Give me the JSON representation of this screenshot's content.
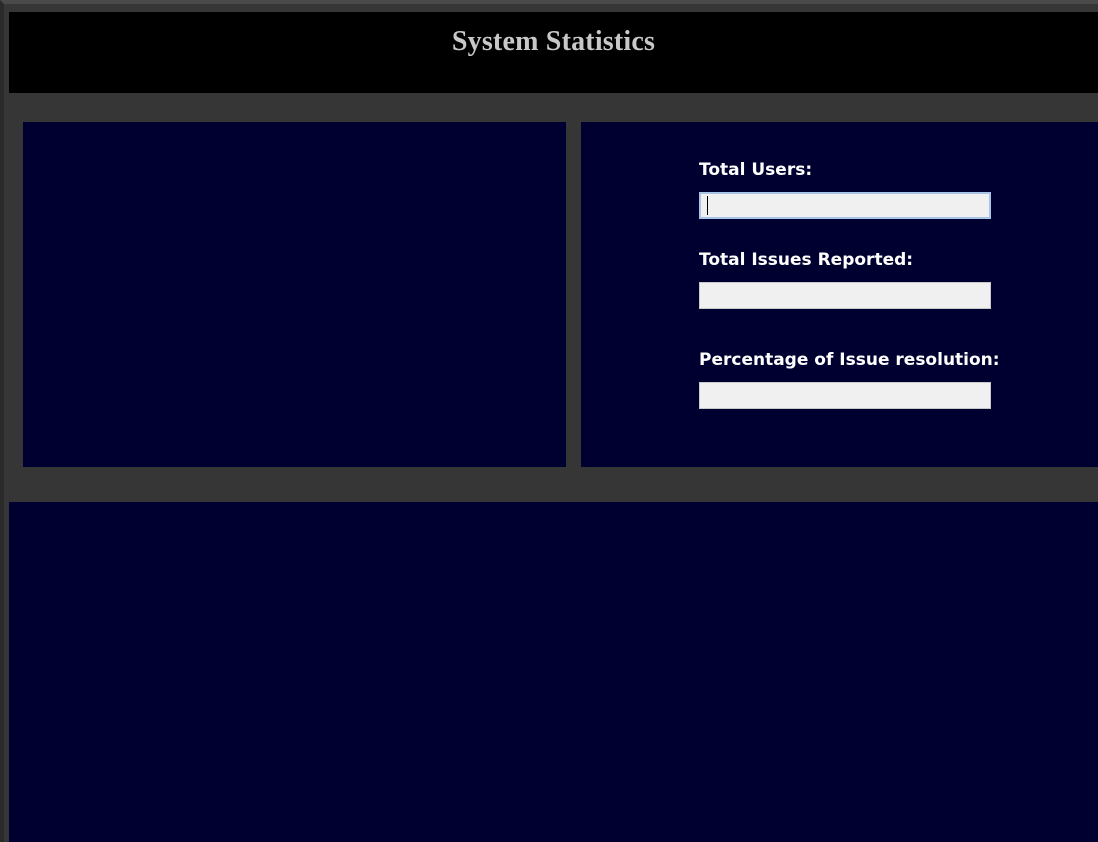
{
  "window": {
    "title": "System Statistics"
  },
  "stats": {
    "total_users": {
      "label": "Total Users:",
      "value": "",
      "placeholder": ""
    },
    "total_issues": {
      "label": "Total Issues Reported:",
      "value": "",
      "placeholder": ""
    },
    "resolution_pct": {
      "label": "Percentage of Issue resolution:",
      "value": "",
      "placeholder": ""
    }
  },
  "colors": {
    "background": "#363636",
    "title_bar": "#000000",
    "title_text": "#c8c8c8",
    "panel": "#000030",
    "label_text": "#ffffff",
    "input_bg": "#f0f0f0",
    "focus_border": "#a9c4e8"
  }
}
